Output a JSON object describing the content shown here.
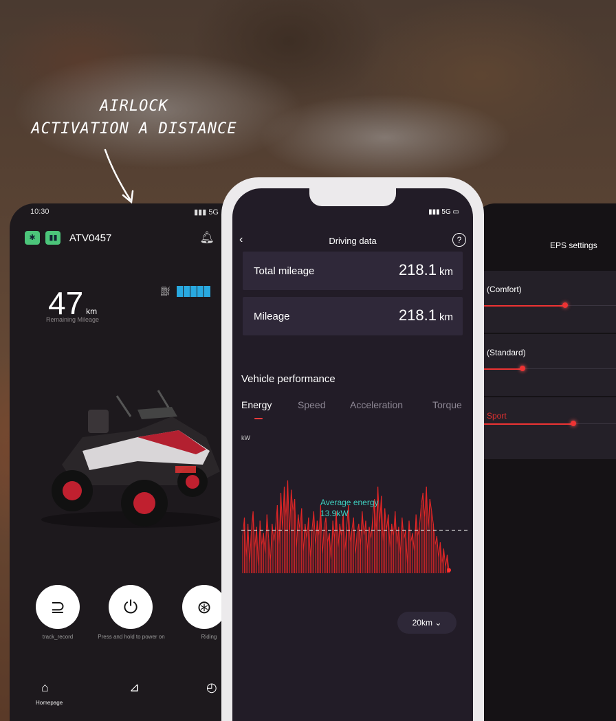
{
  "annotation": {
    "line1": "AIRLOCK",
    "line2": "ACTIVATION A DISTANCE"
  },
  "left_phone": {
    "time": "10:30",
    "signal": "5G",
    "vehicle_id": "ATV0457",
    "remaining": {
      "value": "47",
      "unit": "km",
      "label": "Remaining Mileage"
    },
    "actions": [
      {
        "icon": "track-icon",
        "label": "track_record"
      },
      {
        "icon": "power-icon",
        "label": "Press and hold to power on"
      },
      {
        "icon": "steering-icon",
        "label": "Riding"
      }
    ],
    "nav": [
      {
        "icon": "home-icon",
        "label": "Homepage"
      },
      {
        "icon": "navigate-icon",
        "label": ""
      },
      {
        "icon": "gauge-icon",
        "label": ""
      }
    ]
  },
  "center_phone": {
    "signal": "5G",
    "title": "Driving data",
    "stats": [
      {
        "label": "Total mileage",
        "value": "218.1",
        "unit": "km"
      },
      {
        "label": "Mileage",
        "value": "218.1",
        "unit": "km"
      }
    ],
    "section_title": "Vehicle performance",
    "tabs": [
      "Energy",
      "Speed",
      "Acceleration",
      "Torque"
    ],
    "active_tab": "Energy",
    "y_unit": "kW",
    "average": {
      "label": "Average energy",
      "value": "13.9kW"
    },
    "range_select": "20km"
  },
  "chart_data": {
    "type": "line",
    "title": "",
    "xlabel": "",
    "ylabel": "kW",
    "average_line": 13.9,
    "ylim": [
      0,
      40
    ],
    "x": [
      0,
      1,
      2,
      3,
      4,
      5,
      6,
      7,
      8,
      9,
      10,
      11,
      12,
      13,
      14,
      15,
      16,
      17,
      18,
      19,
      20,
      21,
      22,
      23,
      24,
      25,
      26,
      27,
      28,
      29,
      30,
      31,
      32,
      33,
      34,
      35,
      36,
      37,
      38,
      39,
      40,
      41,
      42,
      43,
      44,
      45,
      46,
      47,
      48,
      49,
      50,
      51,
      52,
      53,
      54,
      55,
      56,
      57,
      58,
      59,
      60,
      61,
      62,
      63,
      64,
      65,
      66,
      67,
      68,
      69,
      70,
      71,
      72,
      73,
      74,
      75,
      76,
      77,
      78,
      79,
      80,
      81,
      82,
      83,
      84,
      85,
      86,
      87,
      88,
      89,
      90,
      91,
      92,
      93,
      94,
      95,
      96,
      97,
      98,
      99,
      100,
      101,
      102,
      103,
      104,
      105,
      106,
      107,
      108,
      109,
      110,
      111,
      112,
      113,
      114,
      115,
      116,
      117,
      118,
      119
    ],
    "series": [
      {
        "color": "#e32626",
        "values": [
          12,
          18,
          5,
          16,
          3,
          14,
          20,
          8,
          15,
          2,
          17,
          9,
          13,
          6,
          19,
          11,
          4,
          16,
          10,
          15,
          22,
          9,
          26,
          14,
          28,
          18,
          30,
          12,
          27,
          20,
          24,
          8,
          19,
          14,
          21,
          7,
          16,
          11,
          18,
          5,
          14,
          20,
          9,
          17,
          12,
          22,
          6,
          15,
          18,
          10,
          13,
          4,
          17,
          11,
          20,
          8,
          16,
          12,
          19,
          7,
          15,
          22,
          10,
          14,
          18,
          6,
          13,
          16,
          9,
          20,
          12,
          17,
          7,
          15,
          11,
          18,
          24,
          13,
          28,
          16,
          25,
          10,
          21,
          14,
          19,
          8,
          16,
          12,
          20,
          9,
          15,
          6,
          18,
          11,
          14,
          3,
          17,
          10,
          13,
          7,
          19,
          12,
          15,
          22,
          26,
          18,
          28,
          14,
          24,
          20,
          16,
          9,
          12,
          5,
          10,
          3,
          8,
          2,
          6,
          1
        ]
      }
    ]
  },
  "right_phone": {
    "title": "EPS settings",
    "modes": [
      {
        "label": "(Comfort)",
        "level": 0.62,
        "color": "#ffffff"
      },
      {
        "label": "(Standard)",
        "level": 0.3,
        "color": "#ffffff"
      },
      {
        "label": "Sport",
        "level": 0.68,
        "color": "#e03030"
      }
    ]
  }
}
